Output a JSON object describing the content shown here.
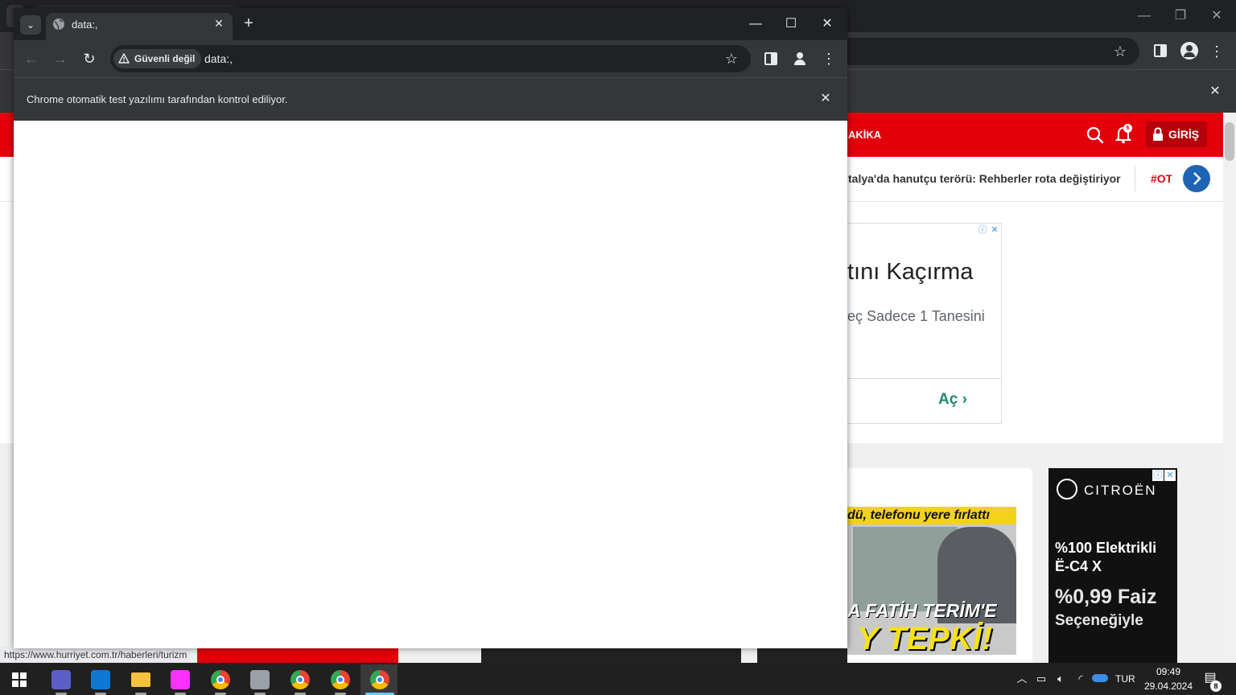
{
  "background_window": {
    "nav_partial": "AKİKA",
    "login_label": "GİRİŞ",
    "notification_count": "6",
    "ticker_text": "talya'da hanutçu terörü: Rehberler rota değiştiriyor",
    "ticker_tag": "#OT",
    "ad_top": {
      "headline_partial": "tını Kaçırma",
      "sub_partial": "eç Sadece 1 Tanesini",
      "cta": "Aç"
    },
    "news": {
      "headline_partial": "dü, telefonu yere fırlattı",
      "caption_partial": "A FATİH TERİM'E",
      "caption_big": "Y TEPKİ!"
    },
    "ad_right": {
      "brand": "CITROËN",
      "line1": "%100 Elektrikli",
      "line2": "Ë-C4 X",
      "line3": "%0,99 Faiz",
      "line4": "Seçeneğiyle"
    },
    "status_url": "https://www.hurriyet.com.tr/haberleri/turizm"
  },
  "front_window": {
    "tab_title": "data:,",
    "security_label": "Güvenli değil",
    "url": "data:,",
    "infobar_text": "Chrome otomatik test yazılımı tarafından kontrol ediliyor."
  },
  "taskbar": {
    "apps": [
      {
        "name": "Microsoft Teams",
        "icon": "teams-icon",
        "color": "#5b5fc7"
      },
      {
        "name": "Outlook (new)",
        "icon": "outlook-icon",
        "color": "#0f78d4"
      },
      {
        "name": "File Explorer",
        "icon": "folder-icon",
        "color": "#f8c33c"
      },
      {
        "name": "IntelliJ IDEA",
        "icon": "intellij-icon",
        "color": "#fc31fe"
      },
      {
        "name": "Google Chrome",
        "icon": "chrome-icon",
        "color": "#4285f4"
      },
      {
        "name": "Network Drive",
        "icon": "network-drive-icon",
        "color": "#9aa0a6"
      },
      {
        "name": "Google Chrome",
        "icon": "chrome-icon",
        "color": "#4285f4"
      },
      {
        "name": "Google Chrome",
        "icon": "chrome-icon",
        "color": "#4285f4"
      },
      {
        "name": "Google Chrome",
        "icon": "chrome-icon",
        "color": "#4285f4"
      }
    ],
    "language": "TUR",
    "time": "09:49",
    "date": "29.04.2024",
    "notification_count": "8"
  },
  "colors": {
    "site_red": "#e3000b",
    "chrome_dark": "#202124",
    "chrome_toolbar": "#35363a",
    "taskbar": "#202020",
    "accent_blue": "#60cdff"
  }
}
